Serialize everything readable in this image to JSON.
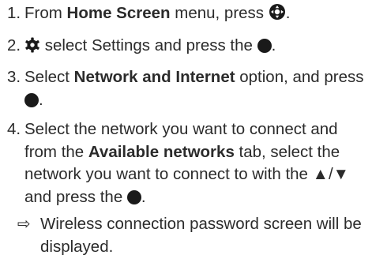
{
  "steps": [
    {
      "number": "1.",
      "parts": [
        "From ",
        "Home Screen",
        " menu, press ",
        "."
      ]
    },
    {
      "number": "2.",
      "parts": [
        " select Settings and press the ",
        "."
      ]
    },
    {
      "number": "3.",
      "parts": [
        "Select ",
        "Network and Internet",
        " option, and press ",
        "."
      ]
    },
    {
      "number": "4.",
      "parts": [
        "Select the network you want to connect and from the ",
        "Available networks",
        " tab, select the network you want to connect to with the ",
        "▲/▼",
        " and press the ",
        "."
      ]
    }
  ],
  "result": {
    "arrow": "⇨",
    "text": "Wireless connection password screen will be displayed."
  },
  "icons": {
    "directional_pad": "dpad-icon",
    "settings": "gear-icon",
    "ok_button": "ok-dot-icon",
    "color": "#1a1a1a"
  }
}
